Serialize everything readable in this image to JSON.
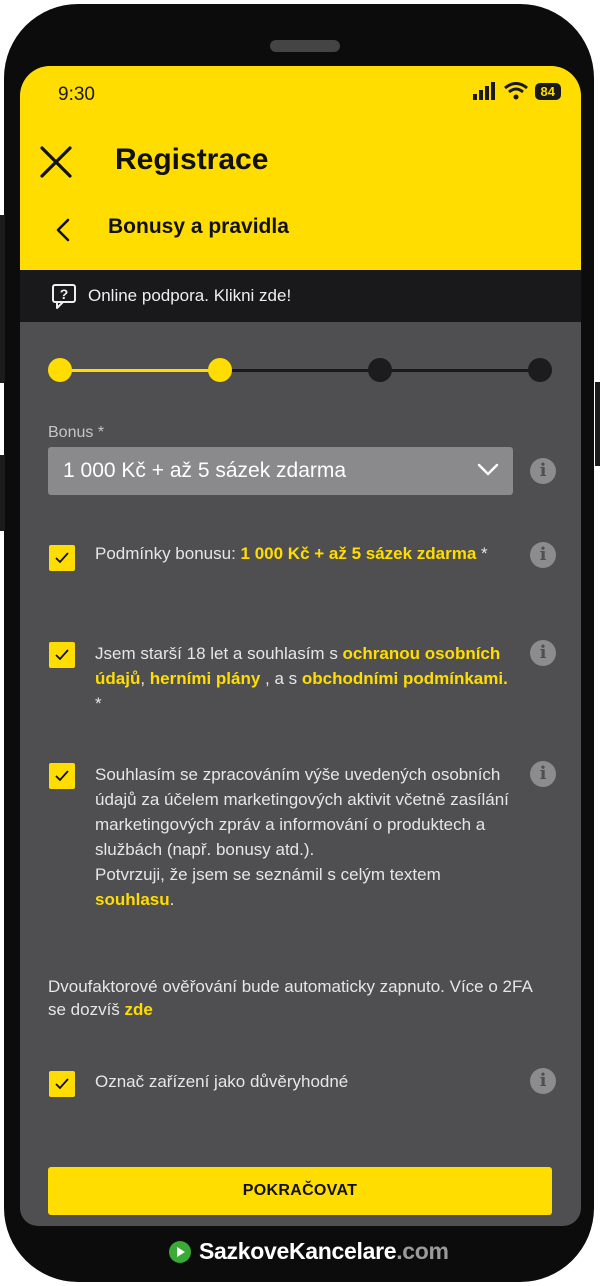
{
  "status_bar": {
    "time": "9:30",
    "battery": "84"
  },
  "header": {
    "title": "Registrace",
    "subtitle": "Bonusy a pravidla"
  },
  "support": {
    "label": "Online podpora. Klikni zde!"
  },
  "bonus": {
    "label": "Bonus *",
    "selected": "1 000 Kč + až 5 sázek zdarma"
  },
  "consents": [
    {
      "prefix": "Podmínky bonusu: ",
      "link": "1 000 Kč + až 5 sázek zdarma",
      "suffix": " *",
      "checked": true
    },
    {
      "prefix": "Jsem starší 18 let a souhlasím s ",
      "link1": "ochranou osobních údajů",
      "mid1": ", ",
      "link2": "herními plány",
      "mid2": " , a s ",
      "link3": "obchodními podmínkami.",
      "suffix": " *",
      "checked": true
    },
    {
      "text": "Souhlasím se zpracováním výše uvedených osobních údajů za účelem marketingových aktivit včetně zasílání marketingových zpráv a informování o produktech a službách (např. bonusy atd.).",
      "text2": "Potvrzuji, že jsem se seznámil s celým textem ",
      "link": "souhlasu",
      "suffix": ".",
      "checked": true
    }
  ],
  "twofa": {
    "text": "Dvoufaktorové ověřování bude automaticky zapnuto. Více o 2FA se dozvíš ",
    "link": "zde"
  },
  "trusted_device": {
    "label": "Označ zařízení jako důvěryhodné",
    "checked": true
  },
  "cta": {
    "label": "POKRAČOVAT"
  },
  "watermark": {
    "part1": "SazkoveKancelare",
    "part2": ".com"
  },
  "colors": {
    "accent": "#ffdd00",
    "panel": "#4f4f51",
    "dark_bar": "#19191b"
  },
  "steps": {
    "total": 4,
    "current": 2
  }
}
